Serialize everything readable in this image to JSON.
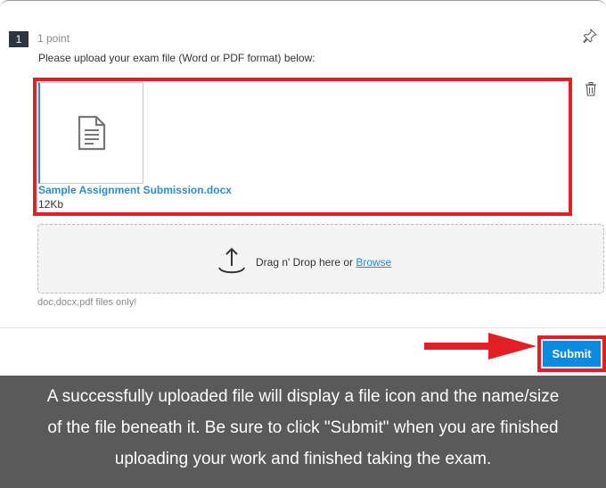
{
  "question": {
    "number": "1",
    "points": "1 point",
    "prompt": "Please upload your exam file (Word or PDF format) below:"
  },
  "uploaded_file": {
    "name": "Sample Assignment Submission.docx",
    "size": "12Kb"
  },
  "dropzone": {
    "text": "Drag n' Drop here or ",
    "browse_label": "Browse",
    "file_types": "doc,docx,pdf files only!"
  },
  "actions": {
    "submit_label": "Submit"
  },
  "caption": {
    "line1": "A successfully uploaded file will display a file icon and the name/size",
    "line2": "of the file beneath it. Be sure to click \"Submit\" when you are finished",
    "line3": "uploading your work and finished taking the exam."
  },
  "icons": {
    "pin": "pin-icon",
    "trash": "trash-icon",
    "document": "document-icon",
    "upload": "upload-icon",
    "arrow": "arrow-right-icon"
  },
  "colors": {
    "highlight_red": "#e31f26",
    "link_blue": "#2a8bd4",
    "submit_blue": "#0b8be0",
    "caption_bg": "#5a5a5a",
    "badge_bg": "#2d3540"
  }
}
